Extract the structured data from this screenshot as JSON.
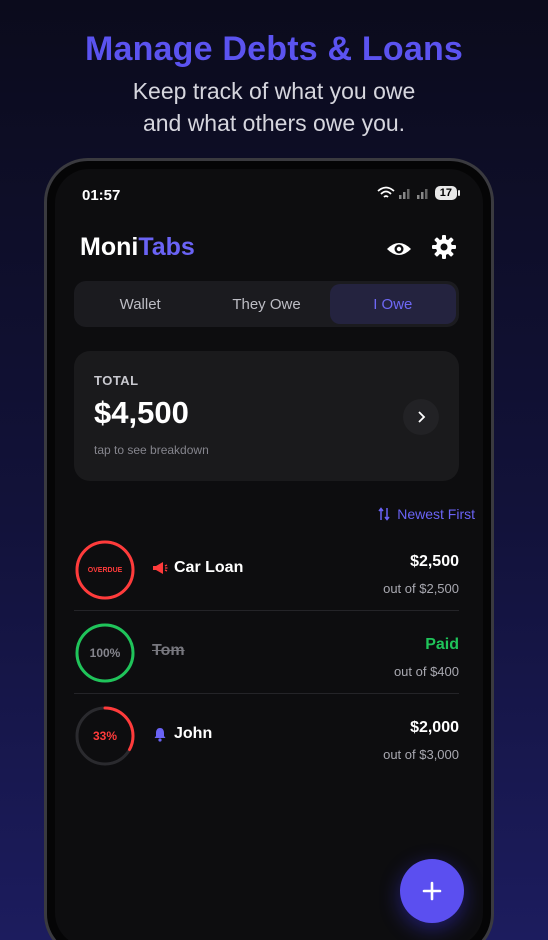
{
  "promo": {
    "headline": "Manage Debts & Loans",
    "subline_1": "Keep track of what you owe",
    "subline_2": "and what others owe you."
  },
  "status_bar": {
    "time": "01:57",
    "battery": "17"
  },
  "header": {
    "title_part1": "Moni",
    "title_part2": "Tabs"
  },
  "tabs": [
    {
      "label": "Wallet",
      "active": false
    },
    {
      "label": "They Owe",
      "active": false
    },
    {
      "label": "I Owe",
      "active": true
    }
  ],
  "total": {
    "label": "TOTAL",
    "amount": "$4,500",
    "hint": "tap to see breakdown"
  },
  "sort": {
    "label": "Newest First"
  },
  "items": [
    {
      "ring_text": "OVERDUE",
      "progress": 1.0,
      "ring_color": "#ff3b3b",
      "name": "Car Loan",
      "icon": "megaphone-icon",
      "amount": "$2,500",
      "out_of": "out of $2,500"
    },
    {
      "ring_text": "100%",
      "progress": 1.0,
      "ring_color": "#1fc45a",
      "name": "Tom",
      "icon": "",
      "amount": "Paid",
      "out_of": "out of $400"
    },
    {
      "ring_text": "33%",
      "progress": 0.33,
      "ring_color": "#ff3b3b",
      "name": "John",
      "icon": "bell-icon",
      "amount": "$2,000",
      "out_of": "out of $3,000"
    }
  ],
  "colors": {
    "accent": "#5b53f0",
    "overdue": "#ff3b3b",
    "paid": "#1fc45a"
  }
}
